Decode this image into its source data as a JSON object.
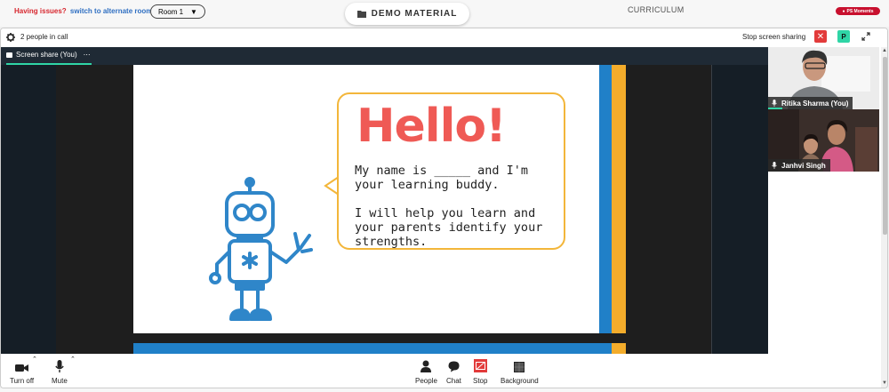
{
  "topbar": {
    "issues_text": "Having issues?",
    "alternate_link": "switch to alternate room",
    "room_select_value": "Room 1",
    "demo_tab": "DEMO MATERIAL",
    "curriculum_tab": "CURRICULUM",
    "moments_badge": "PS Moments"
  },
  "call": {
    "people_count": "2 people in call",
    "stop_sharing_label": "Stop screen sharing",
    "close_icon": "close-icon",
    "avatar_initial": "P",
    "tab_label": "Screen share (You)",
    "tab_more": "⋯"
  },
  "slide": {
    "heading": "Hello!",
    "intro": "My name is _____ and I'm your learning buddy.",
    "help": "I will help you learn and your parents identify your strengths.",
    "colors": {
      "heading": "#ef5a55",
      "bubble_border": "#f3b63a",
      "stripe_blue": "#2080c8",
      "stripe_gold": "#f3ac2b",
      "robot": "#2f86c9"
    }
  },
  "participants": [
    {
      "name": "Ritika Sharma (You)",
      "mic_icon": "mic-icon"
    },
    {
      "name": "Janhvi Singh",
      "mic_icon": "mic-icon"
    }
  ],
  "controls": {
    "camera": "Turn off",
    "mic": "Mute",
    "people": "People",
    "chat": "Chat",
    "stop": "Stop",
    "background": "Background"
  }
}
